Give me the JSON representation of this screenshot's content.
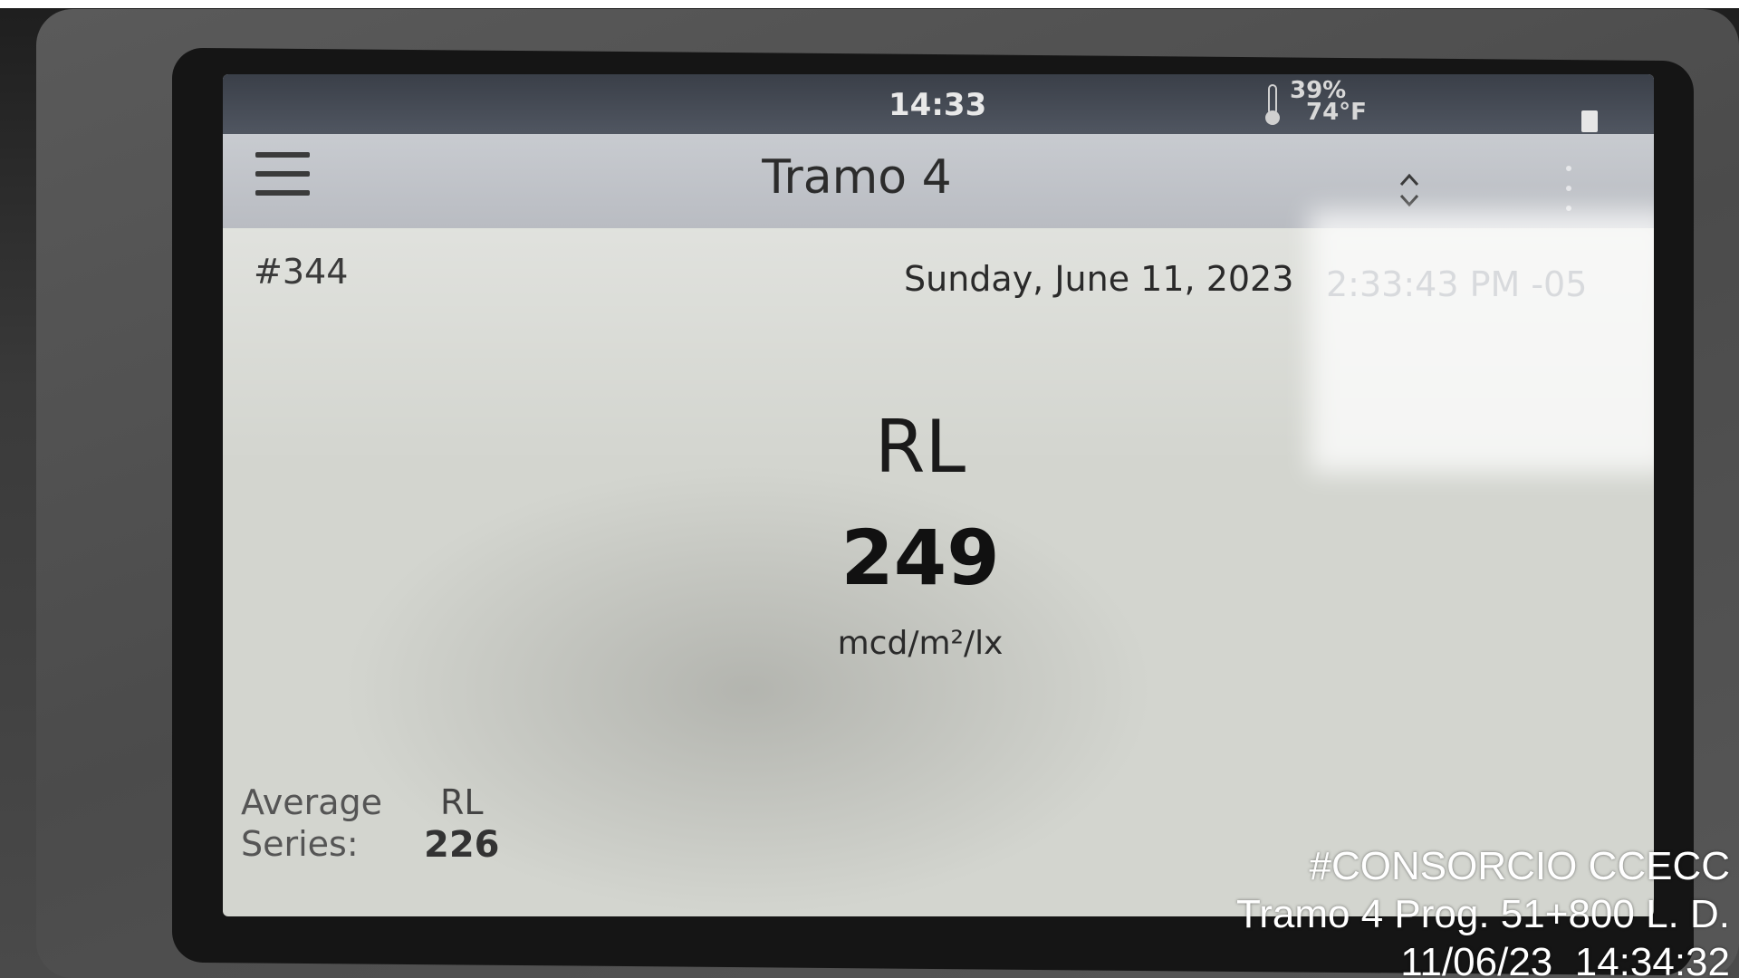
{
  "status_bar": {
    "time": "14:33",
    "humidity": "39%",
    "temperature": "74°F"
  },
  "header": {
    "title": "Tramo 4"
  },
  "record": {
    "number": "#344",
    "date": "Sunday, June 11, 2023",
    "time": "2:33:43 PM -05"
  },
  "measurement": {
    "label": "RL",
    "value": "249",
    "unit": "mcd/m²/lx"
  },
  "average": {
    "label_line1": "Average",
    "label_line2": "Series:",
    "type": "RL",
    "value": "226"
  },
  "watermark": {
    "line1": "#CONSORCIO CCECC",
    "line2": "Tramo 4 Prog. 51+800 L. D.",
    "line3": "11/06/23  14:34:32"
  },
  "icons": {
    "menu": "menu-icon",
    "sort": "up-down-icon",
    "thermometer": "thermometer-icon",
    "battery": "battery-icon"
  }
}
